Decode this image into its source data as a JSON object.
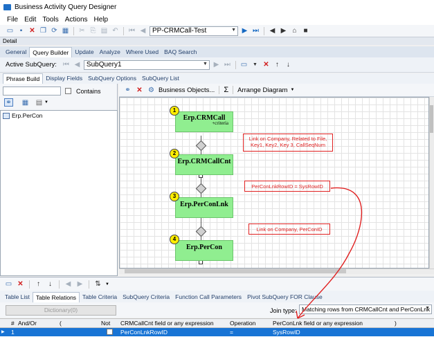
{
  "window": {
    "title": "Business Activity Query Designer"
  },
  "menu": [
    "File",
    "Edit",
    "Tools",
    "Actions",
    "Help"
  ],
  "toolbar": {
    "query_name": "PP-CRMCall-Test"
  },
  "detail_label": "Detail",
  "main_tabs": [
    "General",
    "Query Builder",
    "Update",
    "Analyze",
    "Where Used",
    "BAQ Search"
  ],
  "subquery": {
    "label": "Active SubQuery:",
    "value": "SubQuery1"
  },
  "phrase_tabs": [
    "Phrase Build",
    "Display Fields",
    "SubQuery Options",
    "SubQuery List"
  ],
  "left": {
    "contains_label": "Contains",
    "tree_items": [
      "Erp.PerCon"
    ]
  },
  "diagram_toolbar": {
    "business_objects": "Business Objects...",
    "sigma": "Σ",
    "arrange": "Arrange Diagram"
  },
  "diagram": {
    "tables": [
      {
        "num": "1",
        "name": "Erp.CRMCall",
        "sub": "+criteria"
      },
      {
        "num": "2",
        "name": "Erp.CRMCallCnt",
        "sub": ""
      },
      {
        "num": "3",
        "name": "Erp.PerConLnk",
        "sub": ""
      },
      {
        "num": "4",
        "name": "Erp.PerCon",
        "sub": ""
      }
    ],
    "notes": [
      "Link on Company, Related to File, Key1, Key2, Key 3, CallSeqNum",
      "PerConLnkRowID = SysRowID",
      "Link on Company, PerConID"
    ]
  },
  "bottom_tabs": [
    "Table List",
    "Table Relations",
    "Table Criteria",
    "SubQuery Criteria",
    "Function Call Parameters",
    "Pivot SubQuery FOR Clause"
  ],
  "criteria": {
    "dictionary_label": "Dictionary(0)",
    "join_type_label": "Join type:",
    "join_type_value": "Matching rows from CRMCallCnt and PerConLnk"
  },
  "grid": {
    "headers": [
      "#",
      "And/Or",
      "(",
      "Not",
      "CRMCallCnt field or any expression",
      "Operation",
      "PerConLnk field or any expression",
      ")"
    ],
    "rows": [
      {
        "num": "1",
        "andor": "",
        "open": "",
        "field": "PerConLnkRowID",
        "op": "=",
        "value": "SysRowID",
        "close": ""
      }
    ]
  },
  "colors": {
    "accent": "#1874d5",
    "table_green": "#90ee90",
    "note_red": "#e02020"
  }
}
